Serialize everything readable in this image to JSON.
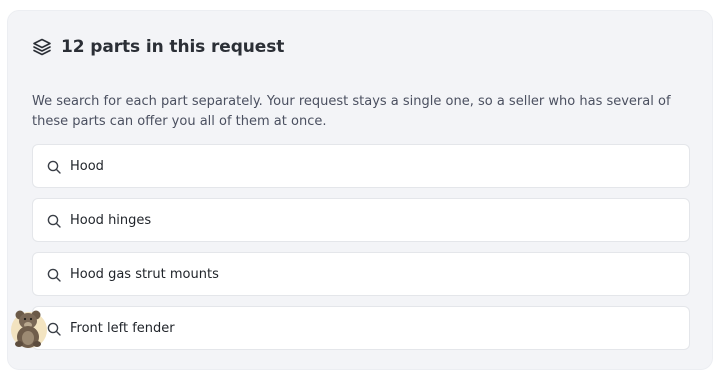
{
  "header": {
    "title": "12 parts in this request",
    "icon": "layers-icon"
  },
  "description": "We search for each part separately. Your request stays a single one, so a seller who has several of these parts can offer you all of them at once.",
  "parts": [
    {
      "label": "Hood",
      "icon": "search-icon"
    },
    {
      "label": "Hood hinges",
      "icon": "search-icon"
    },
    {
      "label": "Hood gas strut mounts",
      "icon": "search-icon"
    },
    {
      "label": "Front left fender",
      "icon": "search-icon"
    }
  ],
  "colors": {
    "panel_bg": "#f3f4f7",
    "item_bg": "#ffffff",
    "text_primary": "#1f2329",
    "text_secondary": "#4b5060"
  }
}
